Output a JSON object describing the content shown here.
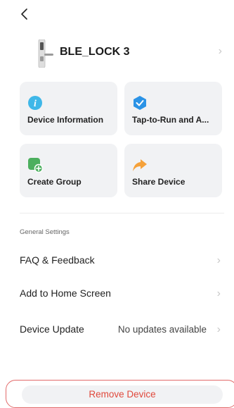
{
  "header": {
    "back_icon": "chevron-left-icon"
  },
  "device": {
    "name": "BLE_LOCK 3",
    "image": "smart-lock-image",
    "chevron": "chevron-right-icon"
  },
  "tiles": [
    {
      "label": "Device Information",
      "icon": "info-icon",
      "color": "#3fb7e8"
    },
    {
      "label": "Tap-to-Run and A...",
      "icon": "checkbox-icon",
      "color": "#2b93e6"
    },
    {
      "label": "Create Group",
      "icon": "create-group-icon",
      "color": "#4caf5e"
    },
    {
      "label": "Share Device",
      "icon": "share-arrow-icon",
      "color": "#f5a13a"
    }
  ],
  "settings": {
    "section_title": "General Settings",
    "rows": [
      {
        "label": "FAQ & Feedback",
        "value": ""
      },
      {
        "label": "Add to Home Screen",
        "value": ""
      },
      {
        "label": "Device Update",
        "value": "No updates available"
      }
    ]
  },
  "remove": {
    "label": "Remove Device",
    "color": "#e0493c"
  }
}
